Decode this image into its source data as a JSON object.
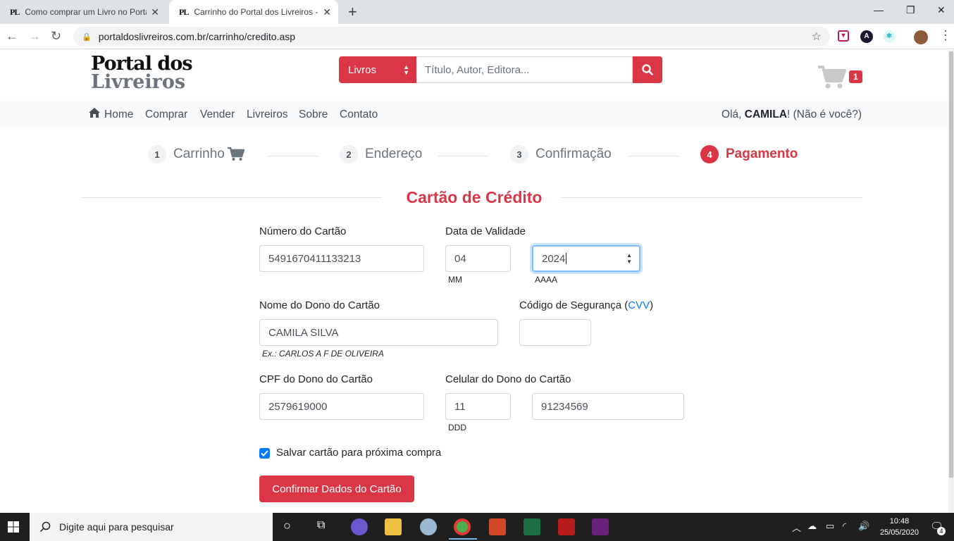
{
  "browser": {
    "tabs": [
      {
        "favicon": "PL",
        "title": "Como comprar um Livro no Porta",
        "active": false
      },
      {
        "favicon": "PL",
        "title": "Carrinho do Portal dos Livreiros -",
        "active": true
      }
    ],
    "url": "portaldoslivreiros.com.br/carrinho/credito.asp"
  },
  "header": {
    "logo_line1": "Portal dos",
    "logo_line2": "Livreiros",
    "search_category": "Livros",
    "search_placeholder": "Título, Autor, Editora...",
    "cart_count": "1"
  },
  "navbar": {
    "items": [
      "Home",
      "Comprar",
      "Vender",
      "Livreiros",
      "Sobre",
      "Contato"
    ],
    "greeting_prefix": "Olá, ",
    "user_name": "CAMILA",
    "greeting_suffix": "! (Não é você?)"
  },
  "steps": [
    {
      "num": "1",
      "label": "Carrinho"
    },
    {
      "num": "2",
      "label": "Endereço"
    },
    {
      "num": "3",
      "label": "Confirmação"
    },
    {
      "num": "4",
      "label": "Pagamento"
    }
  ],
  "form": {
    "title": "Cartão de Crédito",
    "card_number_label": "Número do Cartão",
    "card_number": "5491670411133213",
    "expiry_label": "Data de Validade",
    "expiry_month": "04",
    "expiry_month_hint": "MM",
    "expiry_year": "2024",
    "expiry_year_hint": "AAAA",
    "owner_label": "Nome do Dono do Cartão",
    "owner_name": "CAMILA SILVA",
    "owner_hint": "Ex.: CARLOS A F DE OLIVEIRA",
    "cvv_label_prefix": "Código de Segurança (",
    "cvv_link": "CVV",
    "cvv_label_suffix": ")",
    "cvv_value": "",
    "cpf_label": "CPF do Dono do Cartão",
    "cpf_value": "2579619000",
    "phone_label": "Celular do Dono do Cartão",
    "phone_ddd": "11",
    "phone_ddd_hint": "DDD",
    "phone_number": "91234569",
    "save_card_label": "Salvar cartão para próxima compra",
    "save_card_checked": true,
    "submit_label": "Confirmar Dados do Cartão"
  },
  "taskbar": {
    "search_placeholder": "Digite aqui para pesquisar",
    "time": "10:48",
    "date": "25/05/2020",
    "notifications": "4"
  },
  "colors": {
    "accent": "#dc3545",
    "link": "#007bff"
  }
}
